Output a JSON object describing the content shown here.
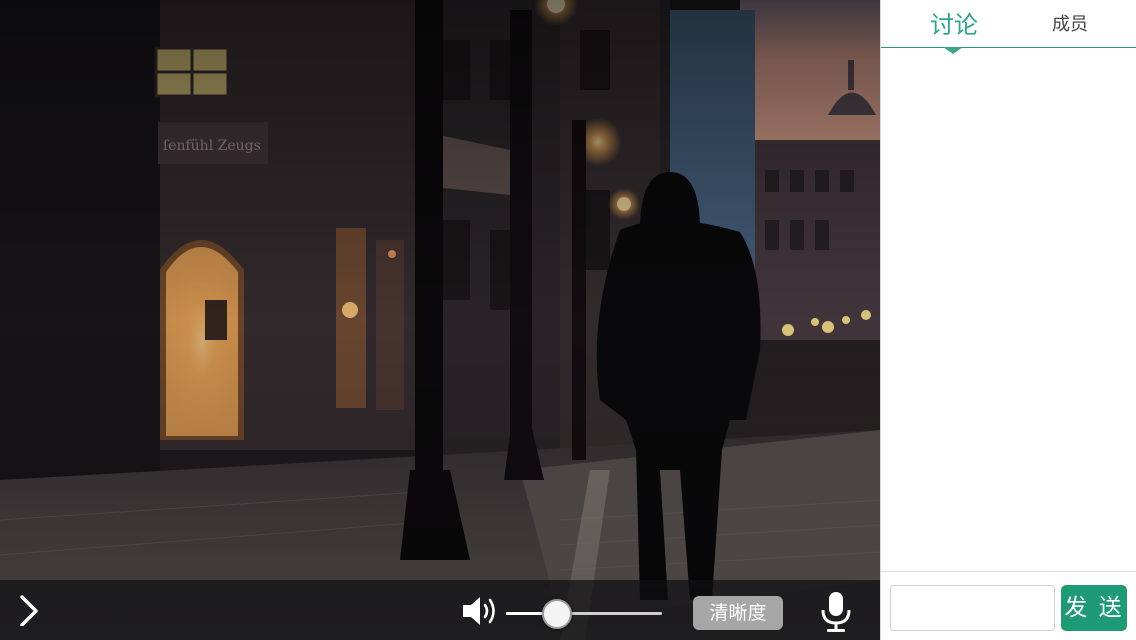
{
  "video": {
    "scene": "street-at-dusk"
  },
  "controls": {
    "volume_level": 0.33,
    "quality_label": "清晰度"
  },
  "panel": {
    "tabs": [
      {
        "label": "讨论",
        "active": true
      },
      {
        "label": "成员",
        "active": false
      }
    ],
    "input_value": "",
    "send_label": "发 送"
  },
  "colors": {
    "accent": "#1e9a74",
    "tab_active": "#2aa58a",
    "control_bar": "#0f0f12"
  }
}
